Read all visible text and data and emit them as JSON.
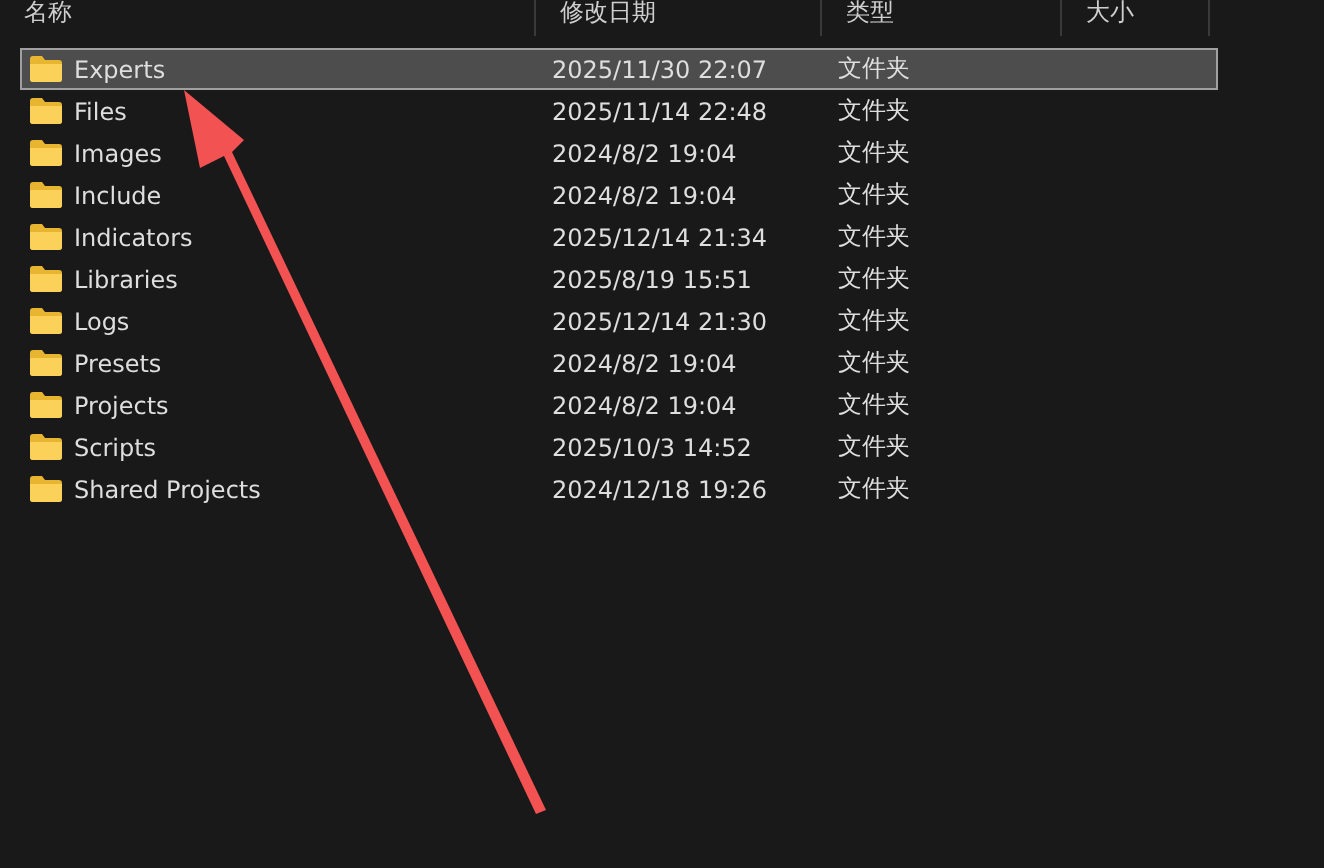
{
  "columns": [
    "名称",
    "修改日期",
    "类型",
    "大小"
  ],
  "rows": [
    {
      "name": "Experts",
      "modified": "2025/11/30 22:07",
      "type": "文件夹",
      "selected": true
    },
    {
      "name": "Files",
      "modified": "2025/11/14 22:48",
      "type": "文件夹",
      "selected": false
    },
    {
      "name": "Images",
      "modified": "2024/8/2 19:04",
      "type": "文件夹",
      "selected": false
    },
    {
      "name": "Include",
      "modified": "2024/8/2 19:04",
      "type": "文件夹",
      "selected": false
    },
    {
      "name": "Indicators",
      "modified": "2025/12/14 21:34",
      "type": "文件夹",
      "selected": false
    },
    {
      "name": "Libraries",
      "modified": "2025/8/19 15:51",
      "type": "文件夹",
      "selected": false
    },
    {
      "name": "Logs",
      "modified": "2025/12/14 21:30",
      "type": "文件夹",
      "selected": false
    },
    {
      "name": "Presets",
      "modified": "2024/8/2 19:04",
      "type": "文件夹",
      "selected": false
    },
    {
      "name": "Projects",
      "modified": "2024/8/2 19:04",
      "type": "文件夹",
      "selected": false
    },
    {
      "name": "Scripts",
      "modified": "2025/10/3 14:52",
      "type": "文件夹",
      "selected": false
    },
    {
      "name": "Shared Projects",
      "modified": "2024/12/18 19:26",
      "type": "文件夹",
      "selected": false
    }
  ]
}
